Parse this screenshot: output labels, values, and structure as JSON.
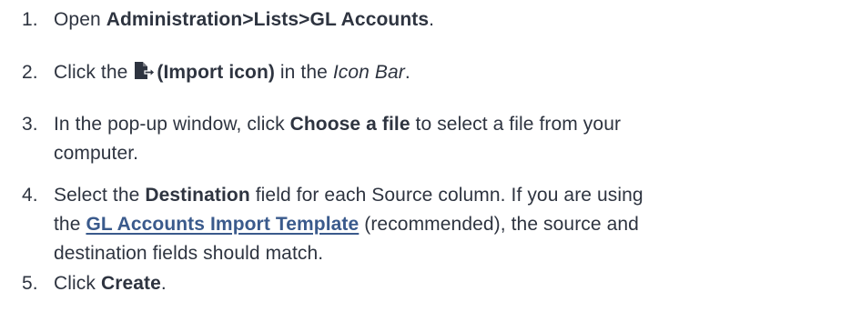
{
  "steps": [
    {
      "number": "1.",
      "pre": "Open ",
      "bold": "Administration>Lists>GL Accounts",
      "post": "."
    },
    {
      "number": "2.",
      "pre": "Click the ",
      "icon": "import-icon",
      "bold": "(Import icon)",
      "mid": " in the ",
      "italic": "Icon Bar",
      "post": "."
    },
    {
      "number": "3.",
      "pre": "In the pop-up window, click ",
      "bold": "Choose a file",
      "post_line1": " to select a file from your",
      "post_line2": "computer."
    },
    {
      "number": "4.",
      "pre": "Select the ",
      "bold": "Destination",
      "post_line1": " field for each Source column. If you are using",
      "line2_pre": "the ",
      "link": "GL Accounts Import Template",
      "line2_post": " (recommended), the source and",
      "line3": "destination fields should match."
    },
    {
      "number": "5.",
      "pre": "Click ",
      "bold": "Create",
      "post": "."
    }
  ]
}
